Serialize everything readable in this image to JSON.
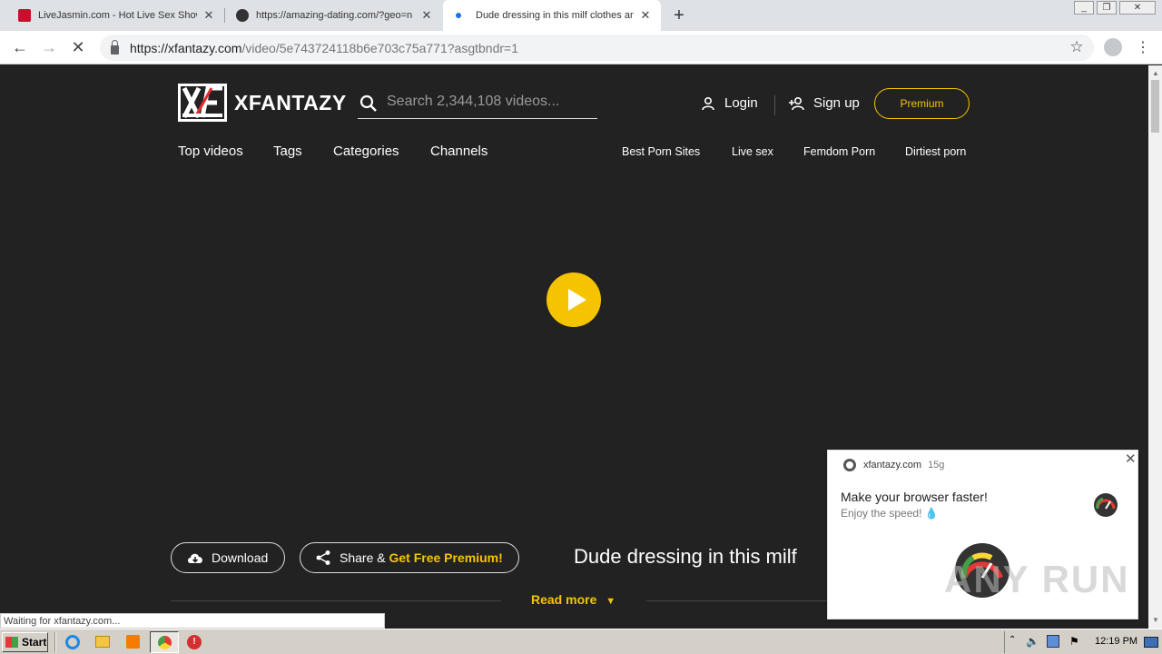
{
  "browser": {
    "tabs": [
      {
        "title": "LiveJasmin.com - Hot Live Sex Shows",
        "favicon_color": "#c8102e"
      },
      {
        "title": "https://amazing-dating.com/?geo=n",
        "favicon_color": "#333333"
      },
      {
        "title": "Dude dressing in this milf clothes and",
        "favicon_color": "#1a73e8"
      }
    ],
    "new_tab_label": "+",
    "window_buttons": [
      "_",
      "❐",
      "✕"
    ],
    "url_host": "https://xfantazy.com",
    "url_path": "/video/5e743724118b6e703c75a771?asgtbndr=1"
  },
  "site": {
    "logo_mark": "XF",
    "logo_text": "XFANTAZY",
    "search_placeholder": "Search 2,344,108 videos...",
    "login": "Login",
    "signup": "Sign up",
    "premium": "Premium",
    "nav_main": [
      "Top videos",
      "Tags",
      "Categories",
      "Channels"
    ],
    "nav_right": [
      "Best Porn Sites",
      "Live sex",
      "Femdom Porn",
      "Dirtiest porn"
    ],
    "download": "Download",
    "share_prefix": "Share &",
    "share_highlight": "Get Free Premium!",
    "video_title": "Dude dressing in this milf",
    "read_more": "Read more",
    "accent": "#f5c400"
  },
  "notification": {
    "source": "xfantazy.com",
    "age": "15g",
    "title": "Make your browser faster!",
    "body": "Enjoy the speed! 💧",
    "watermark": "ANY RUN"
  },
  "status_bar": "Waiting for xfantazy.com...",
  "taskbar": {
    "start": "Start",
    "clock": "12:19 PM"
  }
}
